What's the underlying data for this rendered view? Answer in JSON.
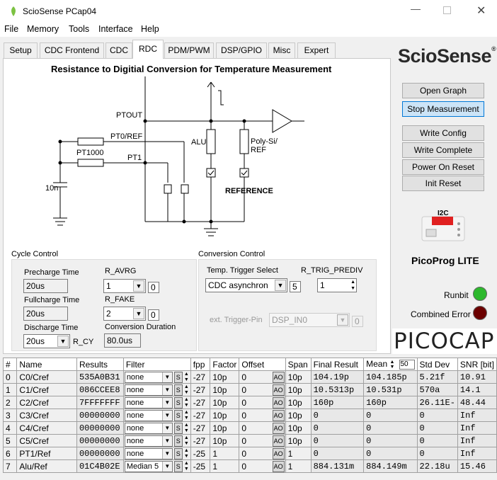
{
  "window": {
    "title": "ScioSense PCap04"
  },
  "menu": [
    "File",
    "Memory",
    "Tools",
    "Interface",
    "Help"
  ],
  "tabs": [
    "Setup",
    "CDC Frontend",
    "CDC",
    "RDC",
    "PDM/PWM",
    "DSP/GPIO",
    "Misc",
    "Expert"
  ],
  "active_tab": "RDC",
  "schematic": {
    "title": "Resistance to Digitial Conversion for Temperature Measurement",
    "labels": {
      "ptout": "PTOUT",
      "pt0": "PT0/REF",
      "pt1000": "PT1000",
      "pt1": "PT1",
      "cap": "10n",
      "alu": "ALU",
      "polysi": "Poly-Si/\nREF",
      "reference": "REFERENCE"
    }
  },
  "cycle_control": {
    "title": "Cycle Control",
    "precharge_label": "Precharge Time",
    "precharge_value": "20us",
    "fullcharge_label": "Fullcharge Time",
    "fullcharge_value": "20us",
    "discharge_label": "Discharge Time",
    "discharge_value": "20us",
    "r_cy": "R_CY",
    "r_avrg_label": "R_AVRG",
    "r_avrg_value": "1",
    "r_avrg_aux": "0",
    "r_fake_label": "R_FAKE",
    "r_fake_value": "2",
    "r_fake_aux": "0",
    "conv_duration_label": "Conversion Duration",
    "conv_duration_value": "80.0us"
  },
  "conversion_control": {
    "title": "Conversion Control",
    "trigger_select_label": "Temp. Trigger Select",
    "trigger_select_value": "CDC asynchron",
    "trigger_aux": "5",
    "prediv_label": "R_TRIG_PREDIV",
    "prediv_value": "1",
    "ext_trigger_label": "ext. Trigger-Pin",
    "ext_trigger_value": "DSP_IN0",
    "ext_aux": "0"
  },
  "right_panel": {
    "logo": "ScioSense",
    "buttons": [
      "Open Graph",
      "Stop Measurement",
      "Write Config",
      "Write Complete",
      "Power On Reset",
      "Init Reset"
    ],
    "i2c_label": "I2C",
    "picoprog_label": "PicoProg LITE",
    "runbit_label": "Runbit",
    "combined_error_label": "Combined Error",
    "picocap_label": "PICOCAP",
    "runbit_color": "#2db82d",
    "error_color": "#6b0000"
  },
  "table": {
    "headers": [
      "#",
      "Name",
      "Results",
      "Filter",
      "fpp",
      "Factor",
      "Offset",
      "Span",
      "Final Result",
      "Mean",
      "Std Dev",
      "SNR [bit]"
    ],
    "mean_window": "50",
    "s_label": "S",
    "ao_label": "AO",
    "rows": [
      {
        "n": "0",
        "name": "C0/Cref",
        "result": "535A0B31",
        "filter": "none",
        "fpp": "-27",
        "factor": "10p",
        "offset": "0",
        "span": "10p",
        "final": "104.19p",
        "mean": "104.185p",
        "std": "5.21f",
        "snr": "10.91"
      },
      {
        "n": "1",
        "name": "C1/Cref",
        "result": "086CCEE8",
        "filter": "none",
        "fpp": "-27",
        "factor": "10p",
        "offset": "0",
        "span": "10p",
        "final": "10.5313p",
        "mean": "10.531p",
        "std": "570a",
        "snr": "14.1"
      },
      {
        "n": "2",
        "name": "C2/Cref",
        "result": "7FFFFFFF",
        "filter": "none",
        "fpp": "-27",
        "factor": "10p",
        "offset": "0",
        "span": "10p",
        "final": "160p",
        "mean": "160p",
        "std": "26.11E-",
        "snr": "48.44"
      },
      {
        "n": "3",
        "name": "C3/Cref",
        "result": "00000000",
        "filter": "none",
        "fpp": "-27",
        "factor": "10p",
        "offset": "0",
        "span": "10p",
        "final": "0",
        "mean": "0",
        "std": "0",
        "snr": "Inf"
      },
      {
        "n": "4",
        "name": "C4/Cref",
        "result": "00000000",
        "filter": "none",
        "fpp": "-27",
        "factor": "10p",
        "offset": "0",
        "span": "10p",
        "final": "0",
        "mean": "0",
        "std": "0",
        "snr": "Inf"
      },
      {
        "n": "5",
        "name": "C5/Cref",
        "result": "00000000",
        "filter": "none",
        "fpp": "-27",
        "factor": "10p",
        "offset": "0",
        "span": "10p",
        "final": "0",
        "mean": "0",
        "std": "0",
        "snr": "Inf"
      },
      {
        "n": "6",
        "name": "PT1/Ref",
        "result": "00000000",
        "filter": "none",
        "fpp": "-25",
        "factor": "1",
        "offset": "0",
        "span": "1",
        "final": "0",
        "mean": "0",
        "std": "0",
        "snr": "Inf"
      },
      {
        "n": "7",
        "name": "Alu/Ref",
        "result": "01C4B02E",
        "filter": "Median 5",
        "fpp": "-25",
        "factor": "1",
        "offset": "0",
        "span": "1",
        "final": "884.131m",
        "mean": "884.149m",
        "std": "22.18u",
        "snr": "15.46"
      }
    ]
  }
}
